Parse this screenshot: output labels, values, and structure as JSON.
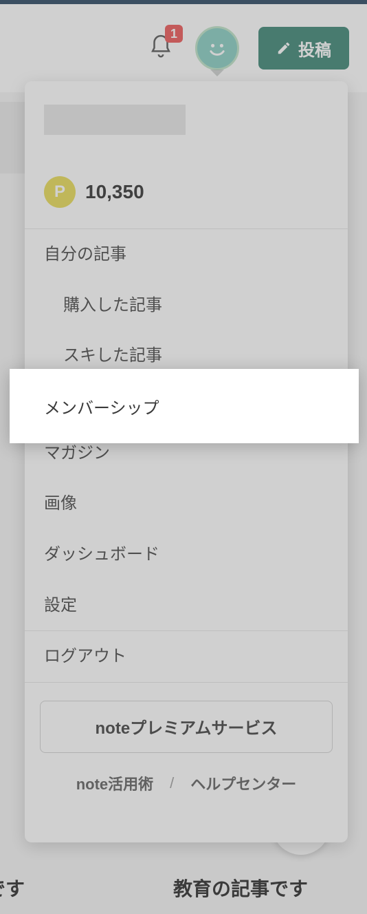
{
  "header": {
    "notification_count": "1",
    "post_button_label": "投稿"
  },
  "dropdown": {
    "points": {
      "badge": "P",
      "value": "10,350"
    },
    "menu": {
      "my_articles": "自分の記事",
      "purchased": "購入した記事",
      "liked": "スキした記事",
      "membership": "メンバーシップ",
      "magazine": "マガジン",
      "images": "画像",
      "dashboard": "ダッシュボード",
      "settings": "設定",
      "logout": "ログアウト"
    },
    "premium_label": "noteプレミアムサービス",
    "footer": {
      "tips": "note活用術",
      "separator": "/",
      "help": "ヘルプセンター"
    }
  },
  "background": {
    "text_left": "です",
    "text_right": "教育の記事です"
  }
}
